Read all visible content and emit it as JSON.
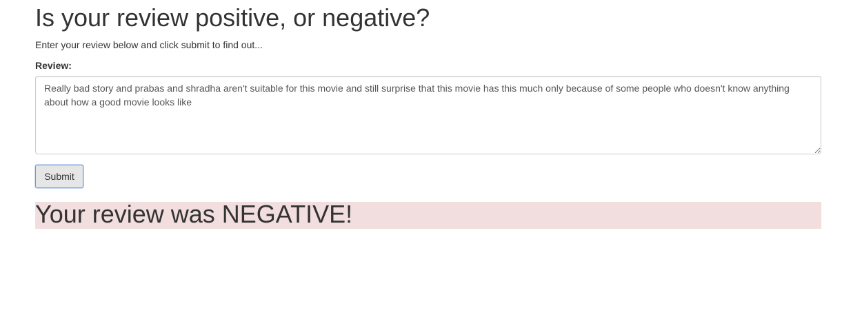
{
  "header": {
    "title": "Is your review positive, or negative?",
    "subtitle": "Enter your review below and click submit to find out..."
  },
  "form": {
    "review_label": "Review:",
    "review_value": "Really bad story and prabas and shradha aren't suitable for this movie and still surprise that this movie has this much only because of some people who doesn't know anything about how a good movie looks like",
    "submit_label": "Submit"
  },
  "result": {
    "text": "Your review was NEGATIVE!",
    "background_color": "#f2dede"
  }
}
